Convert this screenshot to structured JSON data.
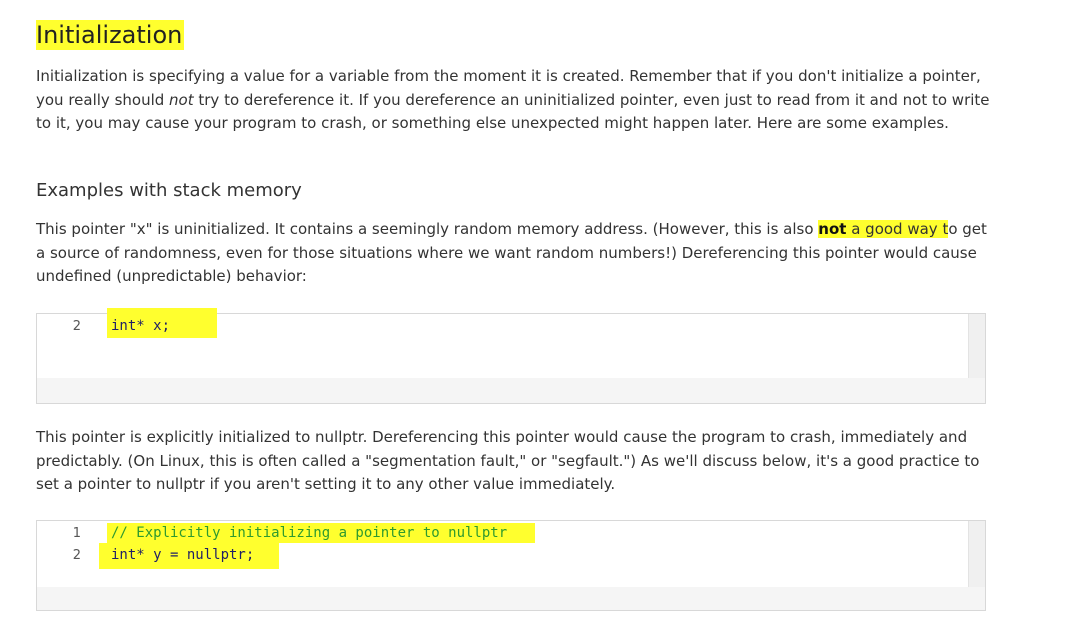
{
  "title": "Initialization",
  "intro": {
    "before": "Initialization is specifying a value for a variable from the moment it is created. Remember that if you don't initialize a pointer, you really should ",
    "emphasis": "not",
    "after": " try to dereference it. If you dereference an uninitialized pointer, even just to read from it and not to write to it, you may cause your program to crash, or something else unexpected might happen later. Here are some examples."
  },
  "subheading": "Examples with stack memory",
  "para1": {
    "before": "This pointer \"x\" is uninitialized. It contains a seemingly random memory address. (However, this is also ",
    "bold": "not",
    "highlighted": " a good way t",
    "after": "o get a source of randomness, even for those situations where we want random numbers!) Dereferencing this pointer would cause undefined (unpredictable) behavior:"
  },
  "code1": {
    "lines": [
      {
        "number": "2",
        "text": "int* x;"
      }
    ]
  },
  "para2": "This pointer is explicitly initialized to nullptr. Dereferencing this pointer would cause the program to crash, immediately and predictably. (On Linux, this is often called a \"segmentation fault,\" or \"segfault.\") As we'll discuss below, it's a good practice to set a pointer to nullptr if you aren't setting it to any other value immediately.",
  "code2": {
    "lines": [
      {
        "number": "1",
        "text": "// Explicitly initializing a pointer to nullptr"
      },
      {
        "number": "2",
        "text": "int* y = nullptr;"
      }
    ]
  },
  "colors": {
    "highlight": "#ffff2e",
    "comment": "#2e9a2e",
    "code": "#1f1f66"
  }
}
